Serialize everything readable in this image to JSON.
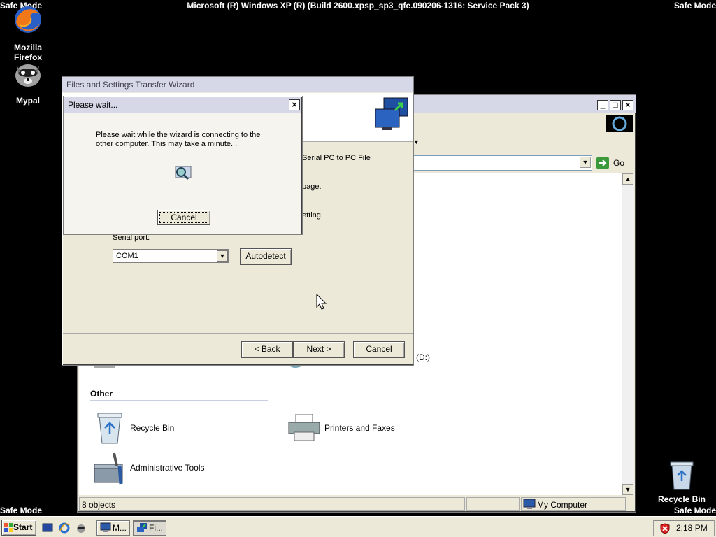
{
  "desktop": {
    "banner": "Microsoft (R) Windows XP (R) (Build 2600.xpsp_sp3_qfe.090206-1316: Service Pack 3)",
    "safe_mode": "Safe Mode",
    "icons": [
      {
        "label": "Mozilla Firefox",
        "icon": "firefox-icon"
      },
      {
        "label": "Mypal",
        "icon": "mypal-icon"
      },
      {
        "label": "Recycle Bin",
        "icon": "recycle-bin-icon"
      }
    ]
  },
  "mycomputer": {
    "go_label": "Go",
    "drive_label": "(D:)",
    "section_other": "Other",
    "items": [
      {
        "label": "Recycle Bin",
        "icon": "recycle-bin-icon"
      },
      {
        "label": "Printers and Faxes",
        "icon": "printer-icon"
      },
      {
        "label": "Administrative Tools",
        "icon": "admin-tools-icon"
      }
    ],
    "status_left": "8 objects",
    "status_right": "My Computer"
  },
  "wizard": {
    "title": "Files and Settings Transfer Wizard",
    "text_serial": "Serial PC to PC File",
    "text_page": "page.",
    "text_setting": "etting.",
    "serial_port_label": "Serial port:",
    "serial_port_value": "COM1",
    "autodetect": "Autodetect",
    "back": "< Back",
    "next": "Next >",
    "cancel": "Cancel"
  },
  "wait_dialog": {
    "title": "Please wait...",
    "message": "Please wait while the wizard is connecting to the other computer. This may take a minute...",
    "cancel": "Cancel"
  },
  "taskbar": {
    "start": "Start",
    "tasks": [
      {
        "label": "M..."
      },
      {
        "label": "Fi..."
      }
    ],
    "clock": "2:18 PM"
  }
}
